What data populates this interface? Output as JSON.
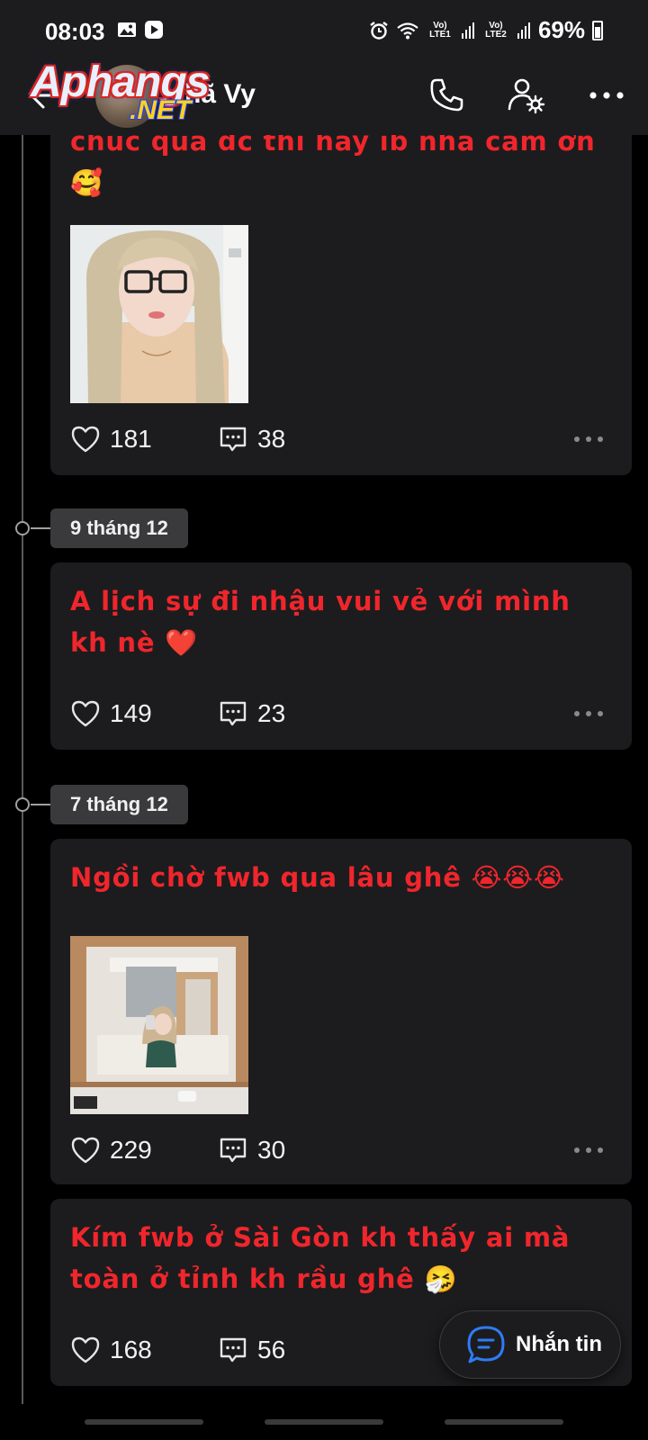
{
  "status_bar": {
    "time": "08:03",
    "sim1": "Vo) LTE1",
    "sim2": "Vo) LTE2",
    "battery": "69%"
  },
  "header": {
    "profile_name": "hã Vy",
    "logo_main": "Aphangs",
    "logo_suffix": ".NET",
    "icons": [
      "back-arrow-icon",
      "phone-icon",
      "user-settings-icon",
      "more-dots-icon"
    ]
  },
  "posts": [
    {
      "text": "chúc quà dc thì hay ib nhà cảm ơn 🥰",
      "likes": "181",
      "comments": "38",
      "has_image": true
    },
    {
      "date": "9 tháng 12",
      "text": "A lịch sự đi nhậu vui vẻ với mình kh nè ❤️",
      "likes": "149",
      "comments": "23"
    },
    {
      "date": "7 tháng 12",
      "text": "Ngồi chờ fwb qua lâu ghê 😭😭😭",
      "likes": "229",
      "comments": "30",
      "has_image": true
    },
    {
      "text": "Kím fwb ở Sài Gòn kh thấy ai mà toàn ở tỉnh kh rầu ghê 🤧",
      "likes": "168",
      "comments": "56"
    }
  ],
  "message_button": {
    "label": "Nhắn tin"
  },
  "colors": {
    "post_text": "#f0262c",
    "card_bg": "#1c1c1e",
    "page_bg": "#000000",
    "date_pill_bg": "#3a3a3c",
    "message_icon": "#2f7bf6"
  }
}
